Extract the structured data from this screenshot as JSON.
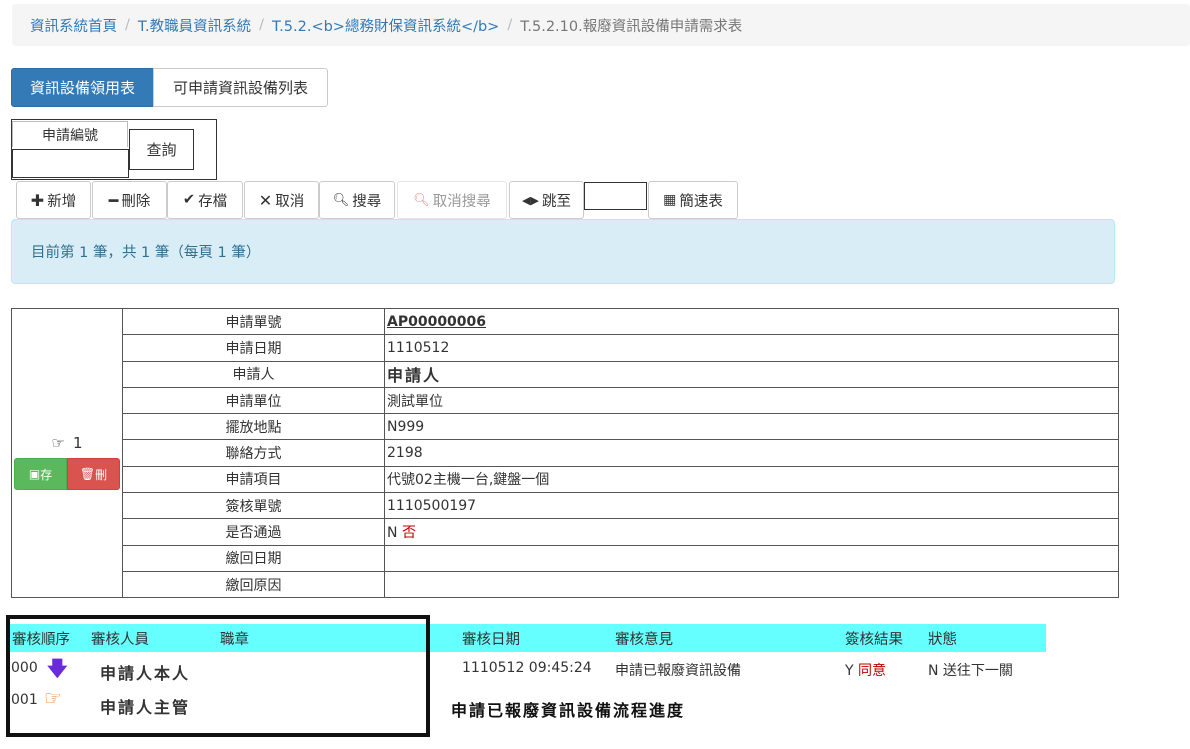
{
  "breadcrumb": {
    "items": [
      "資訊系統首頁",
      "T.教職員資訊系統",
      "T.5.2.<b>總務財保資訊系統</b>"
    ],
    "current": "T.5.2.10.報廢資訊設備申請需求表"
  },
  "tabs": [
    "資訊設備領用表",
    "可申請資訊設備列表"
  ],
  "query": {
    "label": "申請編號",
    "value": "",
    "button": "查詢"
  },
  "toolbar": {
    "add": "新增",
    "delete": "刪除",
    "save": "存檔",
    "cancel": "取消",
    "search": "搜尋",
    "cancel_search": "取消搜尋",
    "jump": "跳至",
    "jump_value": "",
    "quick_table": "簡速表"
  },
  "status_message": "目前第 1 筆，共 1 筆（每頁 1 筆）",
  "record": {
    "index": "1",
    "save_label": "存",
    "delete_label": "刪",
    "rows": [
      {
        "label": "申請單號",
        "value": "AP00000006"
      },
      {
        "label": "申請日期",
        "value": "1110512"
      },
      {
        "label": "申請人",
        "value": "申請人"
      },
      {
        "label": "申請單位",
        "value": "測試單位"
      },
      {
        "label": "擺放地點",
        "value": "N999"
      },
      {
        "label": "聯絡方式",
        "value": "2198"
      },
      {
        "label": "申請項目",
        "value": "代號02主機一台,鍵盤一個"
      },
      {
        "label": "簽核單號",
        "value": "1110500197"
      },
      {
        "label": "是否通過",
        "value": "N",
        "value_extra": "否"
      },
      {
        "label": "繳回日期",
        "value": ""
      },
      {
        "label": "繳回原因",
        "value": ""
      }
    ]
  },
  "review": {
    "headers": [
      "審核順序",
      "審核人員",
      "職章",
      "審核日期",
      "審核意見",
      "簽核結果",
      "狀態"
    ],
    "rows": [
      {
        "order": "000",
        "reviewer": "申請人本人",
        "date": "1110512 09:45:24",
        "opinion": "申請已報廢資訊設備",
        "result_code": "Y",
        "result_text": "同意",
        "status": "N 送往下一關"
      },
      {
        "order": "001",
        "reviewer": "申請人主管",
        "date": "",
        "opinion": "",
        "result_code": "",
        "result_text": "",
        "status": ""
      }
    ],
    "caption": "申請已報廢資訊設備流程進度"
  },
  "colors": {
    "primary": "#337ab7",
    "alert_bg": "#d9edf7",
    "review_header": "#66ffff",
    "success": "#5cb85c",
    "danger": "#d9534f",
    "arrow_purple": "#6a2cd8",
    "hand_orange": "#f07a1c"
  }
}
